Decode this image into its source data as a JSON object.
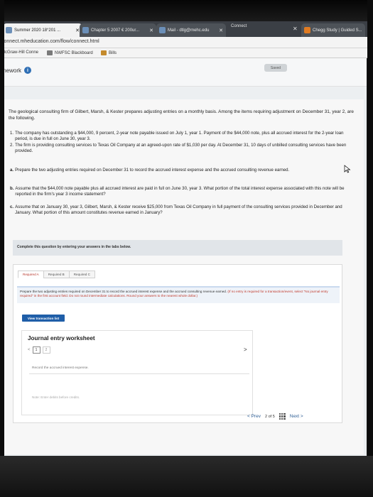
{
  "browser": {
    "tabs": [
      {
        "label": "Summer 2020 18°201 ...",
        "active": true
      },
      {
        "label": "Chapter 5 2007 € 200ur...",
        "active": false
      },
      {
        "label": "Mail - dtlg@mehc.edu",
        "active": false
      },
      {
        "label": "Chegg Study | Guided S...",
        "active": false
      }
    ],
    "connect_tab": "Connect",
    "url": "connect.mheducation.com/flow/connect.html",
    "bookmarks": [
      "McGraw-Hill Conne",
      "NWFSC Blackboard",
      "Bills"
    ]
  },
  "header": {
    "title": "mework",
    "info": "i",
    "saved": "Saved"
  },
  "question": {
    "intro": "The geological consulting firm of Gilbert, Marsh, & Kester prepares adjusting entries on a monthly basis. Among the items requiring adjustment on December 31, year 2, are the following.",
    "items": [
      {
        "num": "1.",
        "text": "The company has outstanding a $44,000, 9 percent, 2-year note payable issued on July 1, year 1. Payment of the $44,000 note, plus all accrued interest for the 2-year loan period, is due in full on June 30, year 3."
      },
      {
        "num": "2.",
        "text": "The firm is providing consulting services to Texas Oil Company at an agreed-upon rate of $1,030 per day. At December 31, 10 days of unbilled consulting services have been provided."
      }
    ],
    "requirements": [
      {
        "letter": "a.",
        "text": "Prepare the two adjusting entries required on December 31 to record the accrued interest expense and the accrued consulting revenue earned."
      },
      {
        "letter": "b.",
        "text": "Assume that the $44,000 note payable plus all accrued interest are paid in full on June 30, year 3. What portion of the total interest expense associated with this note will be reported in the firm's year 3 income statement?"
      },
      {
        "letter": "c.",
        "text": "Assume that on January 30, year 3, Gilbert, Marsh, & Kester receive $25,000 from Texas Oil Company in full payment of the consulting services provided in December and January. What portion of this amount constitutes revenue earned in January?"
      }
    ]
  },
  "answer_area": {
    "complete_label": "Complete this question by entering your answers in the tabs below.",
    "req_tabs": [
      "Required A",
      "Required B",
      "Required C"
    ],
    "instructions": "Prepare the two adjusting entries required on December 31 to record the accrued interest expense and the accrued consulting revenue earned.",
    "instructions_red": "(If no entry is required for a transaction/event, select \"No journal entry required\" in the first account field. Do not round intermediate calculations. Round your answers to the nearest whole dollar.)",
    "view_transaction_list": "View transaction list"
  },
  "journal": {
    "title": "Journal entry worksheet",
    "prev": "<",
    "pages": [
      "1",
      "2"
    ],
    "next": ">",
    "record": "Record the accrued interest expense.",
    "note": "Note: Enter debits before credits."
  },
  "pager": {
    "prev": "< Prev",
    "current": "2",
    "of": "of",
    "total": "5",
    "next": "Next >"
  },
  "colors": {
    "accent": "#1f5ea8",
    "required_tab_active": "#b7352a",
    "info_badge": "#2f6fb5"
  }
}
